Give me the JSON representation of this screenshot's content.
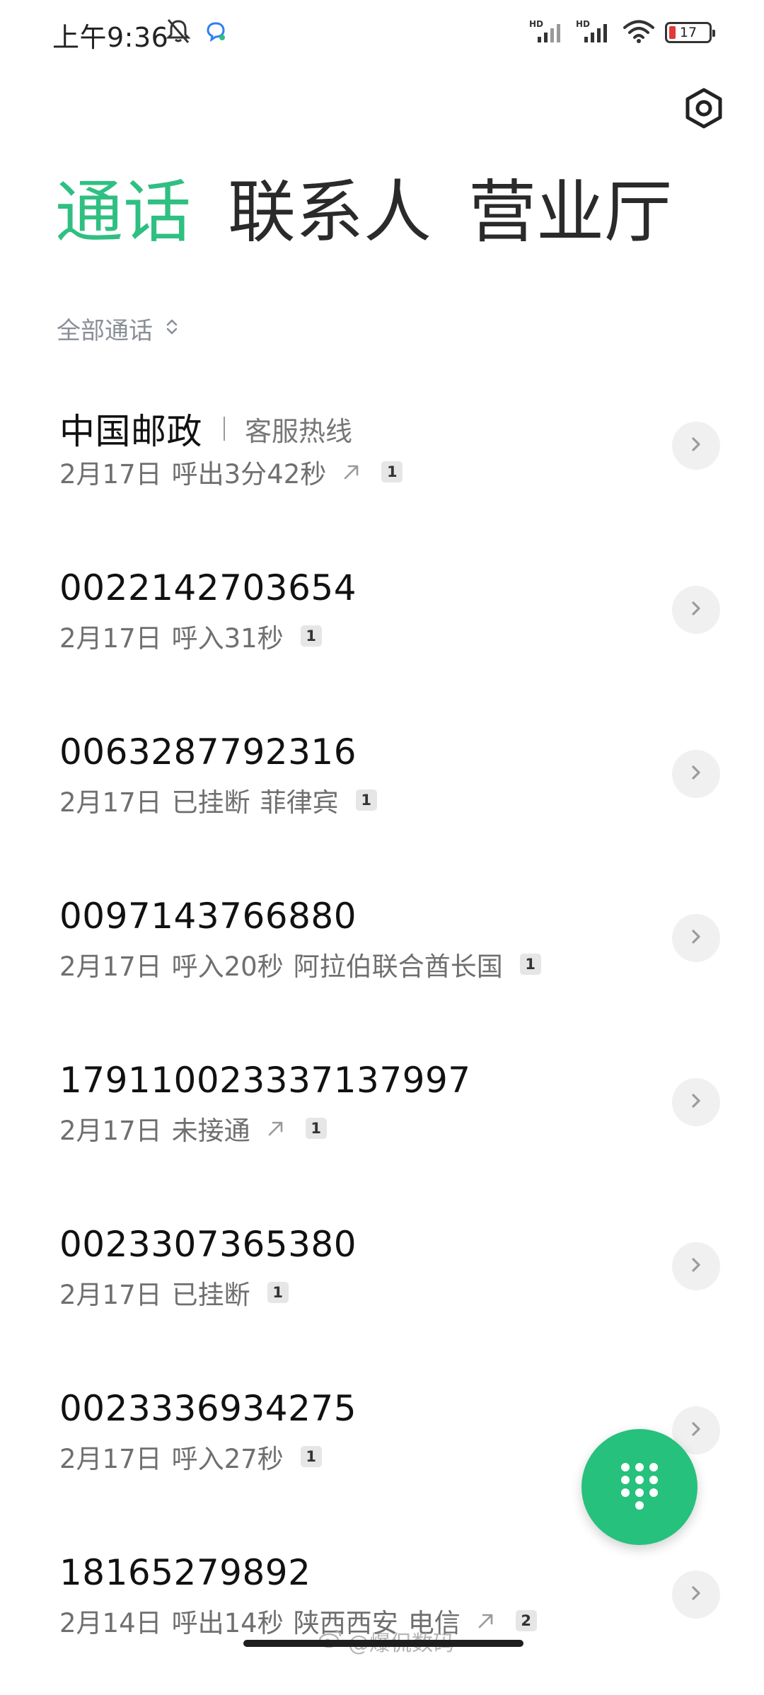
{
  "status_bar": {
    "time": "上午9:36",
    "battery_level": "17",
    "battery_fraction": 0.17,
    "icons": [
      "mute-icon",
      "message-bubble-icon",
      "hd-signal-icon",
      "hd-signal-icon",
      "wifi-icon",
      "battery-icon"
    ],
    "signal_badge": "HD"
  },
  "header": {
    "settings_icon": "hexagon-settings-icon",
    "tabs": [
      {
        "label": "通话",
        "active": true
      },
      {
        "label": "联系人",
        "active": false
      },
      {
        "label": "营业厅",
        "active": false
      }
    ]
  },
  "filter": {
    "label": "全部通话",
    "icon": "sort-chevrons-icon"
  },
  "calls": [
    {
      "name": "中国邮政",
      "tag": "客服热线",
      "details": [
        "2月17日",
        "呼出3分42秒"
      ],
      "outgoing": true,
      "count": "1"
    },
    {
      "name": "0022142703654",
      "tag": "",
      "details": [
        "2月17日",
        "呼入31秒"
      ],
      "outgoing": false,
      "count": "1"
    },
    {
      "name": "0063287792316",
      "tag": "",
      "details": [
        "2月17日",
        "已挂断",
        "菲律宾"
      ],
      "outgoing": false,
      "count": "1"
    },
    {
      "name": "0097143766880",
      "tag": "",
      "details": [
        "2月17日",
        "呼入20秒",
        "阿拉伯联合酋长国"
      ],
      "outgoing": false,
      "count": "1"
    },
    {
      "name": "179110023337137997",
      "tag": "",
      "details": [
        "2月17日",
        "未接通"
      ],
      "outgoing": true,
      "count": "1"
    },
    {
      "name": "0023307365380",
      "tag": "",
      "details": [
        "2月17日",
        "已挂断"
      ],
      "outgoing": false,
      "count": "1"
    },
    {
      "name": "0023336934275",
      "tag": "",
      "details": [
        "2月17日",
        "呼入27秒"
      ],
      "outgoing": false,
      "count": "1"
    },
    {
      "name": "18165279892",
      "tag": "",
      "details": [
        "2月14日",
        "呼出14秒",
        "陕西西安",
        "电信"
      ],
      "outgoing": true,
      "count": "2"
    }
  ],
  "fab": {
    "icon": "dialpad-icon"
  },
  "watermark": {
    "text": "@爆侃数码",
    "icon": "weibo-icon"
  },
  "colors": {
    "accent": "#2fbf82",
    "fab": "#26c17c",
    "battery_low": "#e03a3a"
  }
}
